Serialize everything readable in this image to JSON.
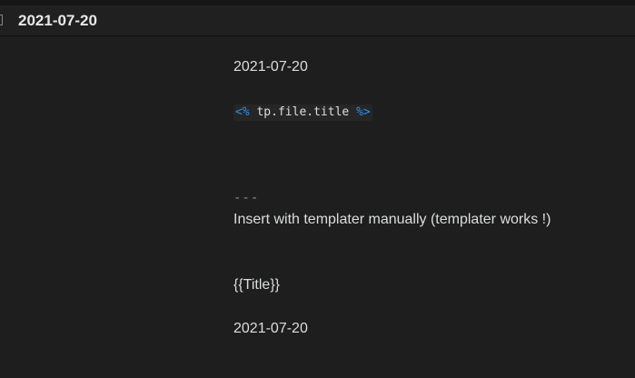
{
  "window": {
    "title": "2021-07-20"
  },
  "editor": {
    "line1": "2021-07-20",
    "template": {
      "open_tag": "<%",
      "expression": "tp.file.title",
      "close_tag": "%>"
    },
    "hr_marker": "---",
    "note": "Insert with templater manually (templater works !)",
    "placeholder": "{{Title}}",
    "line_last": "2021-07-20"
  },
  "colors": {
    "background": "#1e1e1e",
    "titlebar": "#202020",
    "text": "#dcddde",
    "template_tag": "#2f8fe6"
  },
  "icons": {
    "file": "file-icon"
  }
}
